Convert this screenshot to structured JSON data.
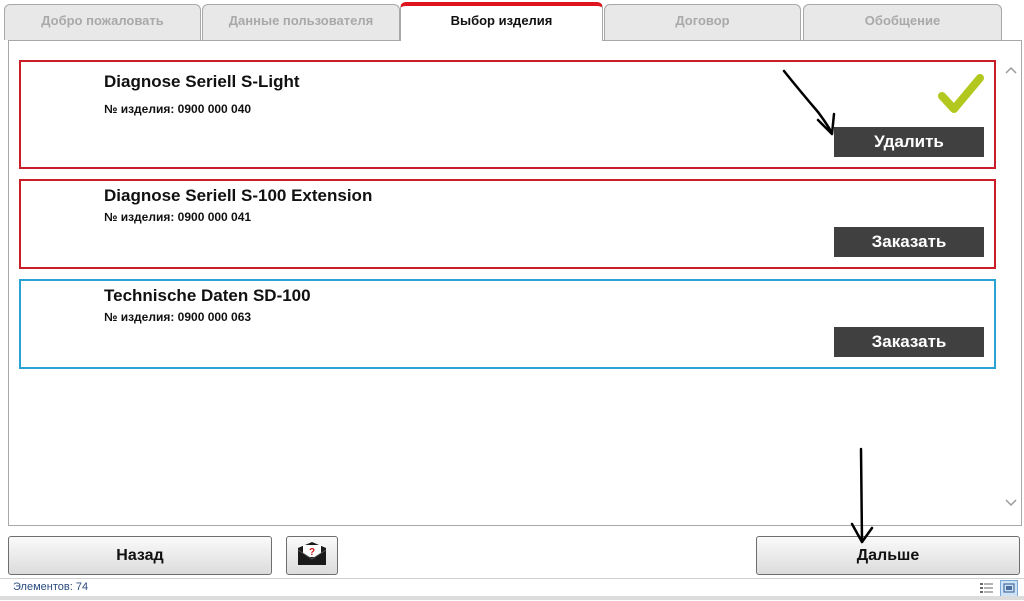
{
  "tabs": [
    {
      "label": "Добро пожаловать",
      "active": false
    },
    {
      "label": "Данные пользователя",
      "active": false
    },
    {
      "label": "Выбор изделия",
      "active": true
    },
    {
      "label": "Договор",
      "active": false
    },
    {
      "label": "Обобщение",
      "active": false
    }
  ],
  "products": [
    {
      "title": "Diagnose Seriell S-Light",
      "number": "№ изделия: 0900 000 040",
      "button": "Удалить",
      "selected": true,
      "icon": "checkmark-icon"
    },
    {
      "title": "Diagnose Seriell S-100 Extension",
      "number": "№ изделия: 0900 000 041",
      "button": "Заказать",
      "selected": false
    },
    {
      "title": "Technische Daten SD-100",
      "number": "№ изделия: 0900 000 063",
      "button": "Заказать",
      "selected": false
    }
  ],
  "footer": {
    "back_label": "Назад",
    "help_icon": "mail-question-icon",
    "next_label": "Дальше"
  },
  "status": {
    "items_text": "Элементов: 74",
    "icons": [
      "details-view-icon",
      "large-icons-view-icon"
    ]
  },
  "colors": {
    "active_tab_accent": "#e0141e",
    "card_border_red": "#c81e28",
    "card_border_blue": "#2aa3d2",
    "button_dark": "#404040",
    "check_green": "#b3c81f"
  }
}
